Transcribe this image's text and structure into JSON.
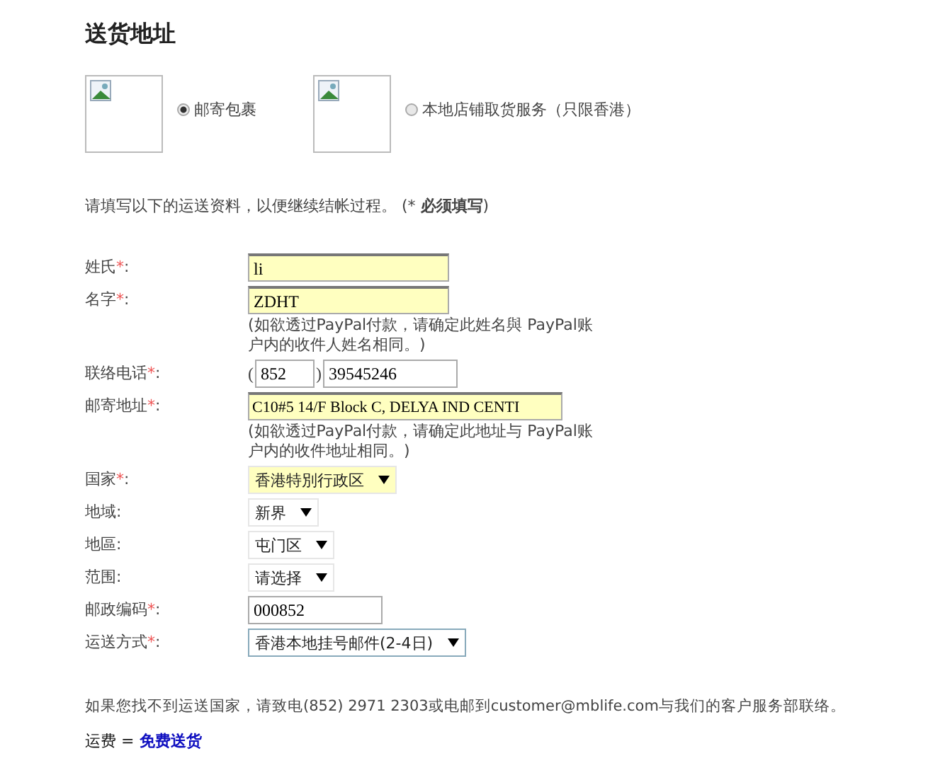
{
  "title": "送货地址",
  "delivery_options": [
    {
      "label": "邮寄包裹",
      "selected": true
    },
    {
      "label": "本地店铺取货服务（只限香港）",
      "selected": false
    }
  ],
  "intro": "请填写以下的运送资料，以便继续结帐过程。 (* **必须填写**)",
  "fields": [
    {
      "kind": "text",
      "label": "姓氏",
      "star": "*",
      "colon": ":",
      "value": "li",
      "highlighted": true
    },
    {
      "kind": "text",
      "label": "名字",
      "star": "*",
      "colon": ":",
      "value": "ZDHT",
      "highlighted": true,
      "note": "(如欲透过PayPal付款，请确定此姓名與 PayPal账户内的收件人姓名相同。)"
    },
    {
      "kind": "phone",
      "label": "联络电话",
      "star": "*",
      "colon": ":",
      "open": "(",
      "code": "852",
      "close": ")",
      "value": "39545246",
      "highlighted": false
    },
    {
      "kind": "text",
      "label": "邮寄地址",
      "star": "*",
      "colon": ":",
      "value": "C10#5  14/F Block C, DELYA IND CENTI",
      "highlighted": true,
      "note": "(如欲透过PayPal付款，请确定此地址与 PayPal账户内的收件地址相同。)"
    },
    {
      "kind": "select",
      "label": "国家",
      "star": "*",
      "colon": ":",
      "value": "香港特別行政区",
      "highlighted": true
    },
    {
      "kind": "select",
      "label": "地域:",
      "value": "新界",
      "highlighted": false
    },
    {
      "kind": "select",
      "label": "地區:",
      "value": "屯门区",
      "highlighted": false
    },
    {
      "kind": "select",
      "label": "范围:",
      "value": "请选择",
      "highlighted": false
    },
    {
      "kind": "text",
      "label": "邮政编码",
      "star": "*",
      "colon": ":",
      "value": "000852",
      "highlighted": false
    },
    {
      "kind": "select",
      "label": "运送方式",
      "star": "*",
      "colon": ":",
      "value": "香港本地挂号邮件(2-4日)",
      "highlighted": false
    }
  ],
  "help_text": "如果您找不到运送国家，请致电(852) 2971 2303或电邮到customer@mblife.com与我们的客户服务部联络。",
  "shipping": {
    "label": "运费 =",
    "value": "免费送货"
  }
}
